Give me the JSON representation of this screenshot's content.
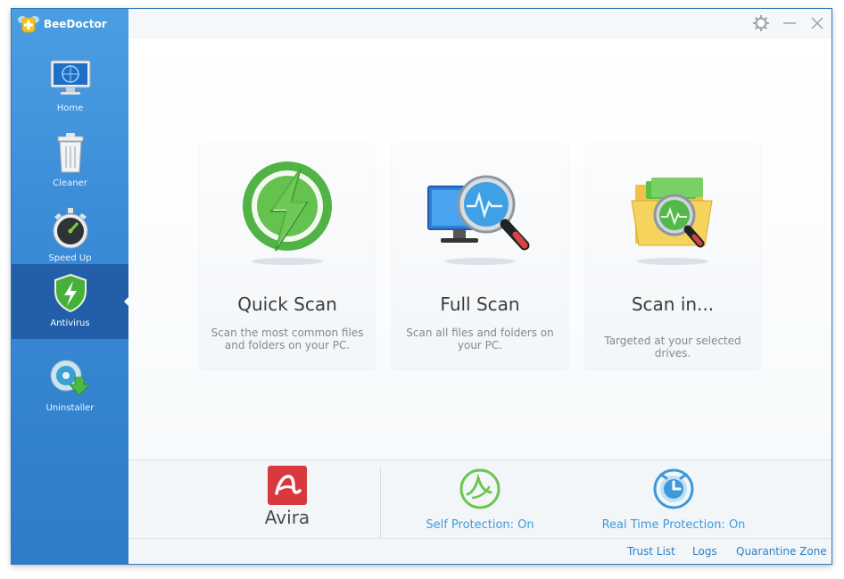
{
  "app": {
    "name": "BeeDoctor"
  },
  "sidebar": {
    "items": [
      {
        "label": "Home",
        "icon": "monitor-icon"
      },
      {
        "label": "Cleaner",
        "icon": "trash-icon"
      },
      {
        "label": "Speed Up",
        "icon": "stopwatch-icon"
      },
      {
        "label": "Antivirus",
        "icon": "shield-icon",
        "active": true
      },
      {
        "label": "Uninstaller",
        "icon": "uninstall-disc-icon"
      }
    ]
  },
  "titlebar": {
    "controls": [
      "gear-icon",
      "minimize-icon",
      "close-icon"
    ]
  },
  "scan_options": [
    {
      "title": "Quick Scan",
      "description": "Scan the most common files and folders on your PC.",
      "icon": "lightning-icon"
    },
    {
      "title": "Full Scan",
      "description": "Scan all files and folders on your PC.",
      "icon": "monitor-magnifier-icon"
    },
    {
      "title": "Scan in...",
      "description": "Targeted at your selected drives.",
      "icon": "folder-magnifier-icon"
    }
  ],
  "protection": {
    "engine": "Avira",
    "self_protection": "Self Protection: On",
    "real_time_protection": "Real Time Protection: On"
  },
  "footer": {
    "links": [
      "Trust List",
      "Logs",
      "Quarantine Zone"
    ]
  },
  "colors": {
    "sidebar": "#3a8bd6",
    "active_item": "#235fa8",
    "accent_link": "#2a7fc9",
    "status_text": "#3d9ad8",
    "avira_red": "#d9393e"
  }
}
